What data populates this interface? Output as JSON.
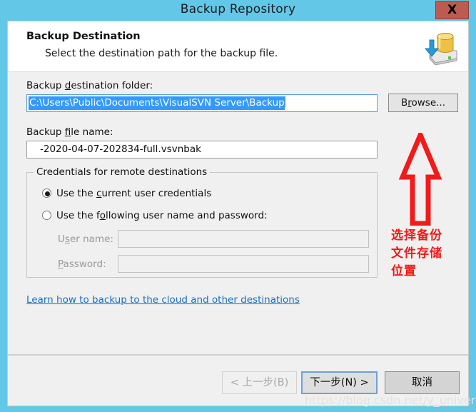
{
  "window": {
    "title": "Backup Repository",
    "close_label": "X",
    "close_bg": "#bc5b50",
    "titlebar_bg": "#63c7e8"
  },
  "header": {
    "title": "Backup Destination",
    "subtitle": "Select the destination path for the backup file.",
    "icon": "backup-database-drive-icon"
  },
  "form": {
    "folder_label_before": "Backup ",
    "folder_label_accel": "d",
    "folder_label_after": "estination folder:",
    "folder_value": "C:\\Users\\Public\\Documents\\VisualSVN Server\\Backup",
    "folder_selected": true,
    "browse_label_before": "B",
    "browse_label_accel": "r",
    "browse_label_after": "owse...",
    "filename_label_before": "Backup ",
    "filename_label_accel": "f",
    "filename_label_after": "ile name:",
    "filename_value": "-2020-04-07-202834-full.vsvnbak"
  },
  "credentials": {
    "legend": "Credentials for remote destinations",
    "option_current_before": "Use the ",
    "option_current_accel": "c",
    "option_current_after": "urrent user credentials",
    "option_current_checked": true,
    "option_following_before": "Use the f",
    "option_following_accel": "o",
    "option_following_after": "llowing user name and password:",
    "option_following_checked": false,
    "username_label_before": "U",
    "username_label_accel": "s",
    "username_label_after": "er name:",
    "username_value": "",
    "password_label_before": "",
    "password_label_accel": "P",
    "password_label_after": "assword:",
    "password_value": "",
    "fields_disabled": true
  },
  "link": {
    "text": "Learn how to backup to the cloud and other destinations",
    "color": "#1a6fc4"
  },
  "annotation": {
    "arrow": "red-up-arrow",
    "color": "#f21a1a",
    "line1": "选择备份",
    "line2": "文件存储",
    "line3": "位置"
  },
  "footer": {
    "back_label": "< 上一步(B)",
    "back_disabled": true,
    "next_label": "下一步(N) >",
    "next_default": true,
    "cancel_label": "取消"
  },
  "watermark": {
    "text": "https://blog.csdn.net/y_universe"
  }
}
